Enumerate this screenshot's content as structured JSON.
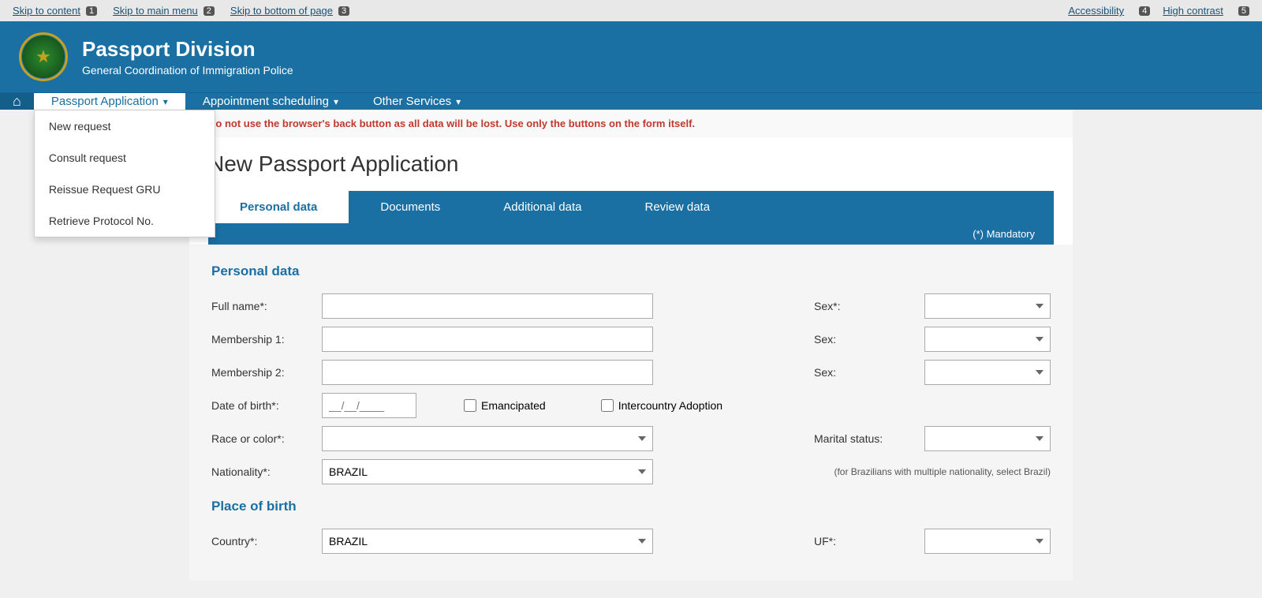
{
  "skip_bar": {
    "links": [
      {
        "label": "Skip to content",
        "num": "1"
      },
      {
        "label": "Skip to main menu",
        "num": "2"
      },
      {
        "label": "Skip to bottom of page",
        "num": "3"
      }
    ],
    "right_links": [
      {
        "label": "Accessibility",
        "num": "4"
      },
      {
        "label": "High contrast",
        "num": "5"
      }
    ]
  },
  "header": {
    "title": "Passport Division",
    "subtitle": "General Coordination of Immigration Police"
  },
  "nav": {
    "home_icon": "⌂",
    "items": [
      {
        "label": "Passport Application",
        "arrow": "▾",
        "active": true,
        "has_dropdown": true
      },
      {
        "label": "Appointment scheduling",
        "arrow": "▾",
        "active": false
      },
      {
        "label": "Other Services",
        "arrow": "▾",
        "active": false
      }
    ],
    "dropdown": [
      {
        "label": "New request"
      },
      {
        "label": "Consult request"
      },
      {
        "label": "Reissue Request GRU"
      },
      {
        "label": "Retrieve Protocol No."
      }
    ]
  },
  "warning": "Do not use the browser's back button as all data will be lost. Use only the buttons on the form itself.",
  "page": {
    "title": "New Passport Application",
    "tabs": [
      {
        "label": "Personal data",
        "active": true
      },
      {
        "label": "Documents",
        "active": false
      },
      {
        "label": "Additional data",
        "active": false
      },
      {
        "label": "Review data",
        "active": false
      }
    ],
    "mandatory_label": "(*) Mandatory"
  },
  "form": {
    "personal_data_title": "Personal data",
    "fullname_label": "Full name*:",
    "fullname_value": "",
    "sex1_label": "Sex*:",
    "sex1_value": "",
    "membership1_label": "Membership 1:",
    "membership1_value": "",
    "sex2_label": "Sex:",
    "sex2_value": "",
    "membership2_label": "Membership 2:",
    "membership2_value": "",
    "sex3_label": "Sex:",
    "sex3_value": "",
    "dob_label": "Date of birth*:",
    "dob_placeholder": "__/__/____",
    "emancipated_label": "Emancipated",
    "intercountry_label": "Intercountry Adoption",
    "race_label": "Race or color*:",
    "race_value": "",
    "marital_label": "Marital status:",
    "marital_value": "",
    "marital_note": "(for Brazilians with multiple nationality, select Brazil)",
    "nationality_label": "Nationality*:",
    "nationality_value": "BRAZIL",
    "place_of_birth_title": "Place of birth",
    "country_label": "Country*:",
    "country_value": "BRAZIL",
    "uf_label": "UF*:",
    "uf_value": ""
  }
}
